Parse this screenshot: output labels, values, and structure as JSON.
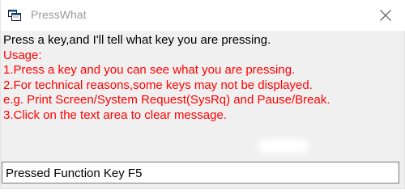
{
  "window": {
    "title": "PressWhat",
    "icon": "app-window-icon",
    "close_icon": "close-icon"
  },
  "message": {
    "intro": "Press a key,and I'll tell what key you are pressing.",
    "usage_heading": "Usage:",
    "lines": [
      "1.Press a key and you can see what you are pressing.",
      "2.For technical reasons,some keys may not be displayed.",
      "e.g. Print Screen/System Request(SysRq) and Pause/Break.",
      "3.Click on the text area to clear message."
    ]
  },
  "status": {
    "value": "Pressed Function Key F5"
  },
  "colors": {
    "instruction_text": "#ff0000",
    "intro_text": "#000000",
    "title_text": "#9a9a9a"
  }
}
